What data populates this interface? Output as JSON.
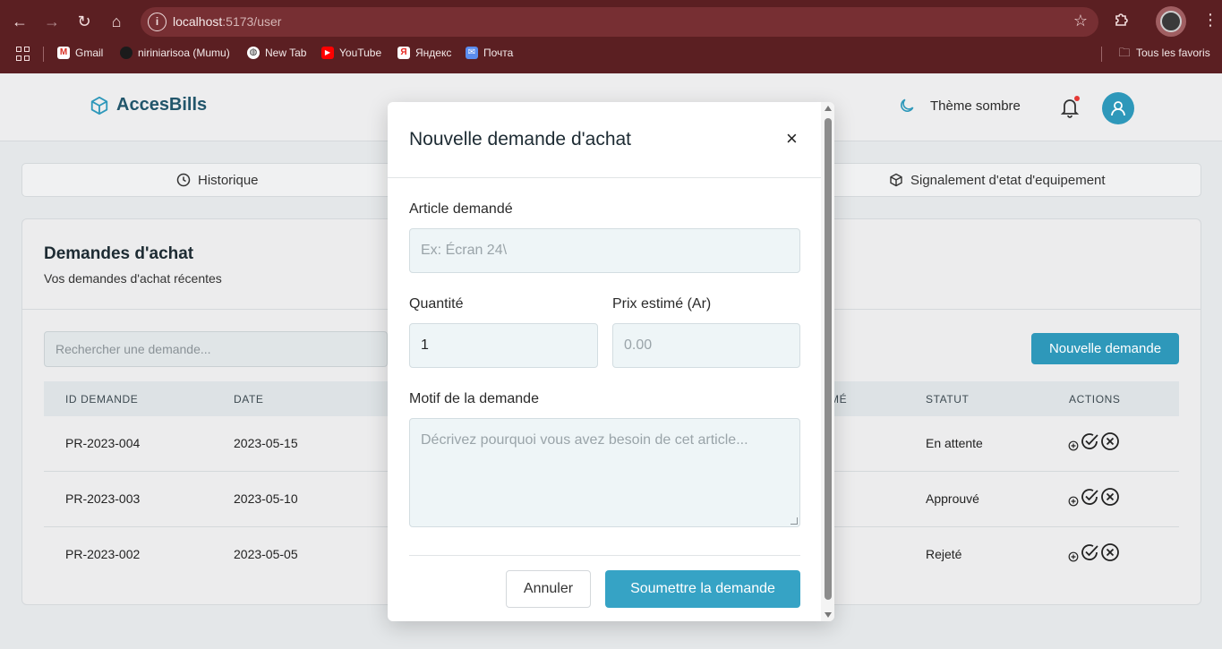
{
  "browser": {
    "url_host": "localhost",
    "url_path": ":5173/user",
    "bookmarks": [
      "Gmail",
      "niriniarisoa (Mumu)",
      "New Tab",
      "YouTube",
      "Яндекс",
      "Почта"
    ],
    "all_bookmarks": "Tous les favoris"
  },
  "header": {
    "brand": "AccesBills",
    "theme_label": "Thème sombre"
  },
  "tabs": {
    "history": "Historique",
    "equipment": "Signalement d'etat d'equipement"
  },
  "card": {
    "title": "Demandes d'achat",
    "subtitle": "Vos demandes d'achat récentes",
    "search_placeholder": "Rechercher une demande...",
    "new_button": "Nouvelle demande",
    "columns": {
      "id": "ID DEMANDE",
      "date": "DATE",
      "price_partial": "MÉ",
      "status": "STATUT",
      "actions": "ACTIONS"
    },
    "rows": [
      {
        "id": "PR-2023-004",
        "date": "2023-05-15",
        "status": "En attente"
      },
      {
        "id": "PR-2023-003",
        "date": "2023-05-10",
        "status": "Approuvé"
      },
      {
        "id": "PR-2023-002",
        "date": "2023-05-05",
        "status": "Rejeté"
      }
    ]
  },
  "modal": {
    "title": "Nouvelle demande d'achat",
    "close": "×",
    "article_label": "Article demandé",
    "article_placeholder": "Ex: Écran 24\\",
    "quantity_label": "Quantité",
    "quantity_value": "1",
    "price_label": "Prix estimé (Ar)",
    "price_placeholder": "0.00",
    "reason_label": "Motif de la demande",
    "reason_placeholder": "Décrivez pourquoi vous avez besoin de cet article...",
    "cancel": "Annuler",
    "submit": "Soumettre la demande"
  },
  "colors": {
    "accent": "#2e98ba",
    "chrome": "#5b1f22"
  }
}
